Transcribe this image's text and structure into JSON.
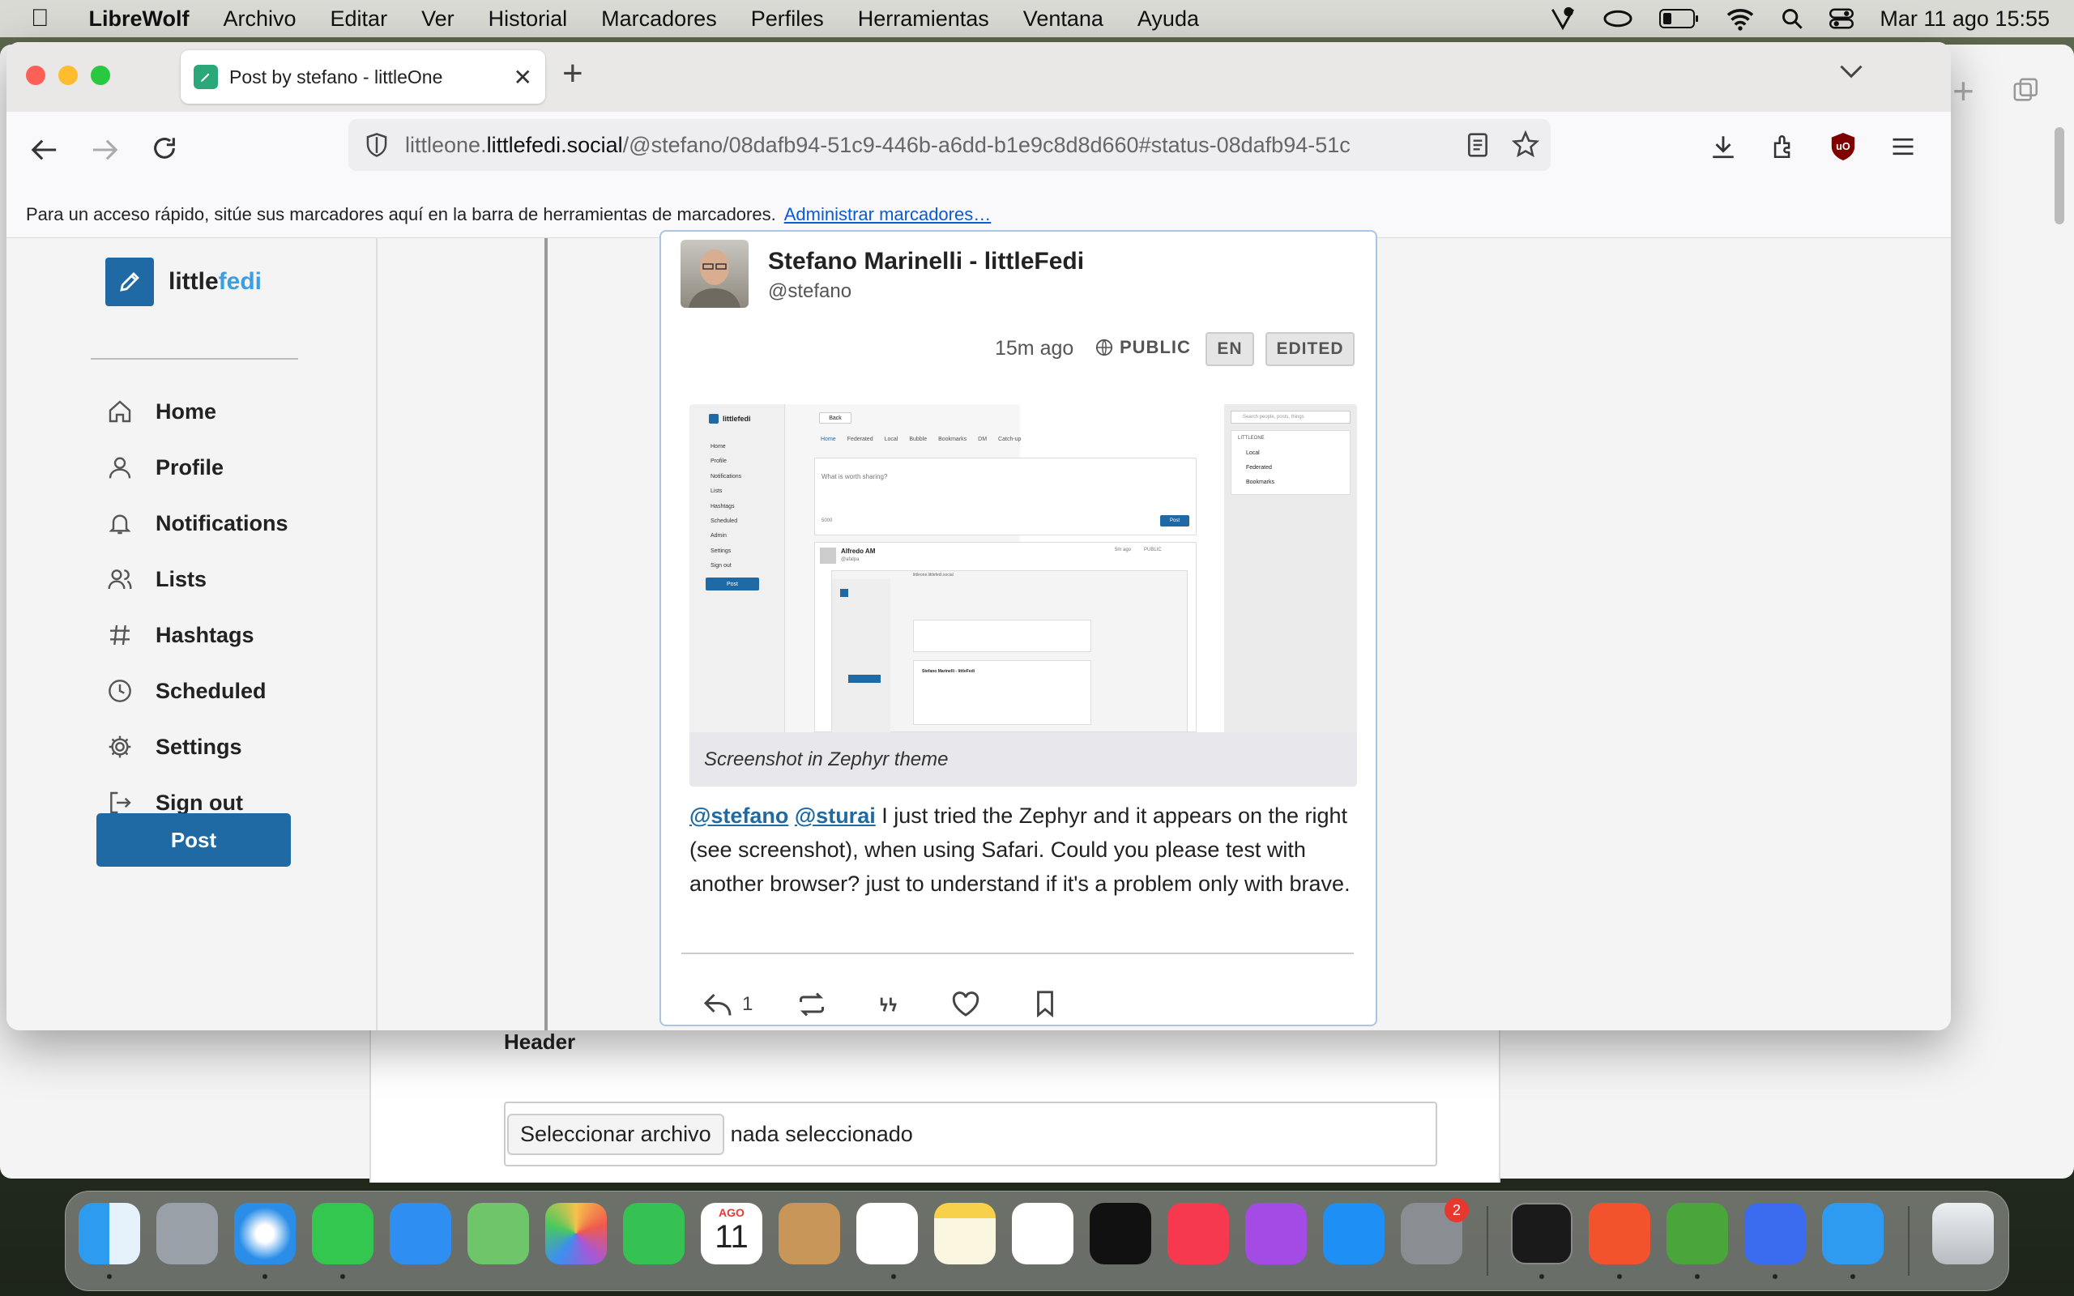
{
  "menubar": {
    "app": "LibreWolf",
    "items": [
      "Archivo",
      "Editar",
      "Ver",
      "Historial",
      "Marcadores",
      "Perfiles",
      "Herramientas",
      "Ventana",
      "Ayuda"
    ],
    "clock": "Mar 11 ago  15:55"
  },
  "browser": {
    "tab_title": "Post by stefano - littleOne",
    "url_host_pre": "littleone.",
    "url_host_main": "littlefedi.social",
    "url_path": "/@stefano/08dafb94-51c9-446b-a6dd-b1e9c8d8d660#status-08dafb94-51c",
    "bookmarks_hint": "Para un acceso rápido, sitúe sus marcadores aquí en la barra de herramientas de marcadores.",
    "bookmarks_link": "Administrar marcadores…"
  },
  "sidebar": {
    "logo_a": "little",
    "logo_b": "fedi",
    "items": [
      {
        "label": "Home",
        "icon": "home-icon"
      },
      {
        "label": "Profile",
        "icon": "user-icon"
      },
      {
        "label": "Notifications",
        "icon": "bell-icon"
      },
      {
        "label": "Lists",
        "icon": "users-icon"
      },
      {
        "label": "Hashtags",
        "icon": "hash-icon"
      },
      {
        "label": "Scheduled",
        "icon": "clock-icon"
      },
      {
        "label": "Settings",
        "icon": "gear-icon"
      },
      {
        "label": "Sign out",
        "icon": "sign-out-icon"
      }
    ],
    "post_button": "Post"
  },
  "post": {
    "author": "Stefano Marinelli - littleFedi",
    "handle": "@stefano",
    "time": "15m ago",
    "visibility": "PUBLIC",
    "lang": "EN",
    "edited": "EDITED",
    "caption": "Screenshot in Zephyr theme",
    "mention1": "@stefano",
    "mention2": "@sturai",
    "text": " I just tried the Zephyr and it appears on the right (see screenshot), when using Safari. Could you please test with another browser? just to understand if it's a problem only with brave.",
    "reply_count": "1"
  },
  "screenshot": {
    "logo": "littlefedi",
    "nav": [
      "Home",
      "Profile",
      "Notifications",
      "Lists",
      "Hashtags",
      "Scheduled",
      "Admin",
      "Settings",
      "Sign out"
    ],
    "post": "Post",
    "back": "Back",
    "tabs": [
      "Home",
      "Federated",
      "Local",
      "Bubble",
      "Bookmarks",
      "DM",
      "Catch-up"
    ],
    "compose": "What is worth sharing?",
    "counter": "5000",
    "search": "Search people, posts, things",
    "right_title": "LITTLEONE",
    "right_items": [
      "Local",
      "Federated",
      "Bookmarks"
    ],
    "inner_author": "Alfredo AM",
    "inner_handle": "@afalpa",
    "inner_time": "5m ago",
    "inner_vis": "PUBLIC",
    "inner_url": "littleone.littlefedi.social",
    "inner_author2": "Stefano Marinelli - littleFedi"
  },
  "background_form": {
    "label": "Header",
    "choose": "Seleccionar archivo",
    "none": "nada seleccionado"
  },
  "dock": {
    "calendar_month": "AGO",
    "calendar_day": "11",
    "settings_badge": "2"
  },
  "colors": {
    "accent": "#1f6aa5",
    "accent_light": "#3c9ee0"
  }
}
